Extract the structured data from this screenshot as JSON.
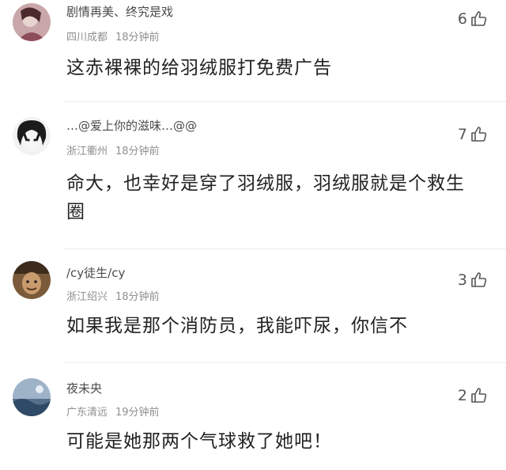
{
  "comments": [
    {
      "username": "剧情再美、终究是戏",
      "location": "四川成都",
      "time": "18分钟前",
      "text": "这赤裸裸的给羽绒服打免费广告",
      "likes": "6",
      "avatar_icon": "avatar-icon"
    },
    {
      "username": "…@爱上你的滋味…@@",
      "location": "浙江衢州",
      "time": "18分钟前",
      "text": "命大，也幸好是穿了羽绒服，羽绒服就是个救生圈",
      "likes": "7",
      "avatar_icon": "avatar-icon"
    },
    {
      "username": "/cy徒生/cy",
      "location": "浙江绍兴",
      "time": "18分钟前",
      "text": "如果我是那个消防员，我能吓尿，你信不",
      "likes": "3",
      "avatar_icon": "avatar-icon"
    },
    {
      "username": "夜未央",
      "location": "广东清远",
      "time": "19分钟前",
      "text": "可能是她那两个气球救了她吧！",
      "likes": "2",
      "avatar_icon": "avatar-icon"
    }
  ],
  "colors": {
    "text": "#222222",
    "meta": "#8f8f8f",
    "name": "#4a4a4a"
  },
  "like_icon": "thumbs-up-icon"
}
